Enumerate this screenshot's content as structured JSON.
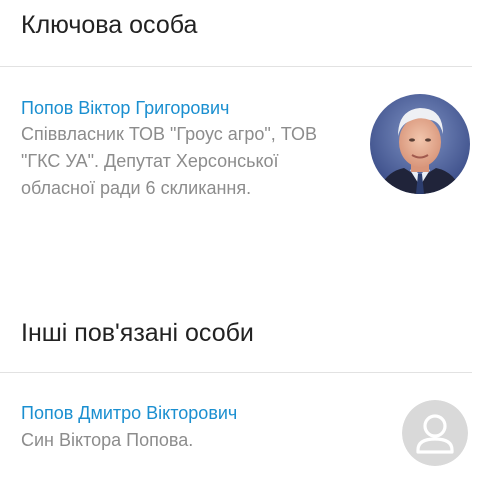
{
  "key_person": {
    "heading": "Ключова особа",
    "name": "Попов Віктор Григорович",
    "description": "Співвласник ТОВ \"Гроус агро\", ТОВ \"ГКС УА\". Депутат Херсонської обласної ради 6 скликання.",
    "avatar_icon": "person-photo"
  },
  "related_persons": {
    "heading": "Інші пов'язані особи",
    "items": [
      {
        "name": "Попов Дмитро Вікторович",
        "description": "Син Віктора Попова.",
        "avatar_icon": "user-placeholder-icon"
      }
    ]
  },
  "colors": {
    "link": "#1a8fd0",
    "muted_text": "#8c8c8c",
    "heading_text": "#222222",
    "divider": "#e2e2e2",
    "placeholder_avatar": "#d9d9d9"
  }
}
